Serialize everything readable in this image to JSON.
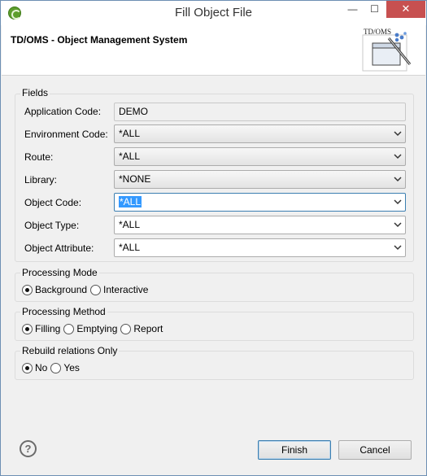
{
  "window": {
    "title": "Fill Object File",
    "minimize_glyph": "—",
    "maximize_glyph": "☐",
    "close_glyph": "✕"
  },
  "header": {
    "title": "TD/OMS - Object Management System",
    "banner_text": "TD/OMS"
  },
  "fields": {
    "legend": "Fields",
    "rows": [
      {
        "label": "Application Code:",
        "value": "DEMO"
      },
      {
        "label": "Environment Code:",
        "value": "*ALL"
      },
      {
        "label": "Route:",
        "value": "*ALL"
      },
      {
        "label": "Library:",
        "value": "*NONE"
      },
      {
        "label": "Object Code:",
        "value": "*ALL"
      },
      {
        "label": "Object Type:",
        "value": "*ALL"
      },
      {
        "label": "Object Attribute:",
        "value": "*ALL"
      }
    ]
  },
  "processing_mode": {
    "legend": "Processing Mode",
    "options": [
      "Background",
      "Interactive"
    ],
    "selected": "Background"
  },
  "processing_method": {
    "legend": "Processing Method",
    "options": [
      "Filling",
      "Emptying",
      "Report"
    ],
    "selected": "Filling"
  },
  "rebuild": {
    "legend": "Rebuild relations Only",
    "options": [
      "No",
      "Yes"
    ],
    "selected": "No"
  },
  "buttons": {
    "help": "?",
    "finish": "Finish",
    "cancel": "Cancel"
  }
}
